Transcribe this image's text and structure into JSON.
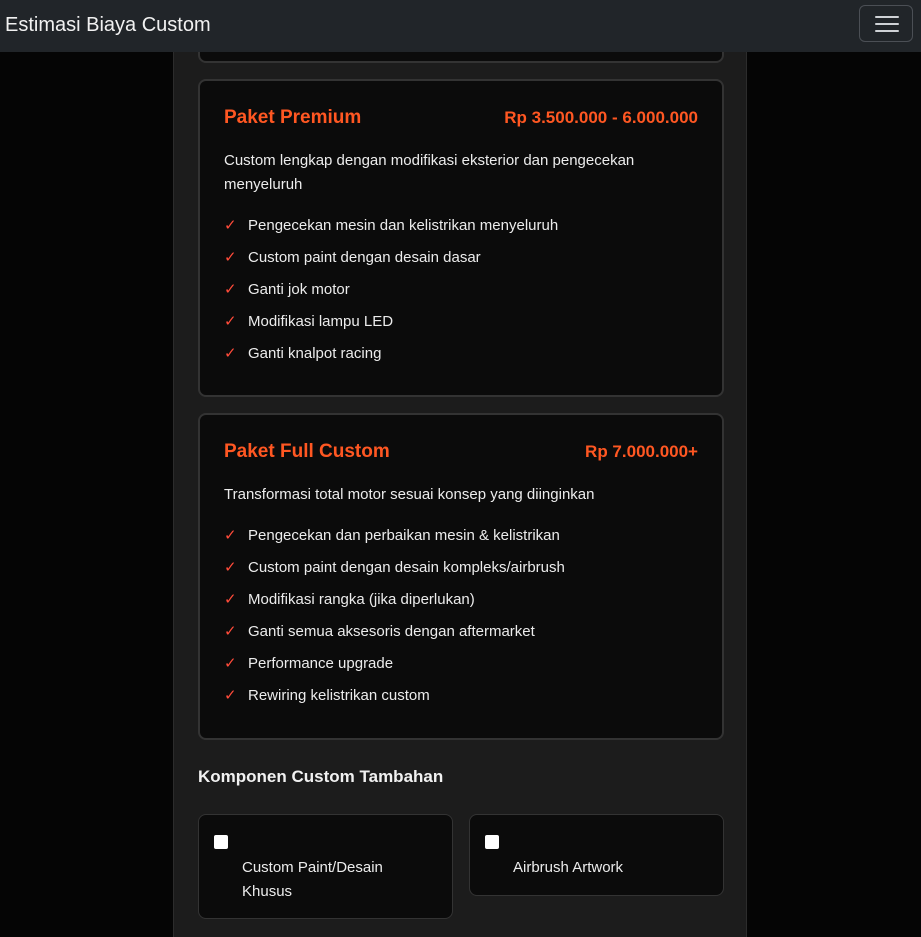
{
  "navbar": {
    "brand": "Estimasi Biaya Custom",
    "toggle_icon": "hamburger-menu-icon"
  },
  "packages": [
    {
      "title": "Paket Premium",
      "price": "Rp 3.500.000 - 6.000.000",
      "description": "Custom lengkap dengan modifikasi eksterior dan pengecekan menyeluruh",
      "features": [
        "Pengecekan mesin dan kelistrikan menyeluruh",
        "Custom paint dengan desain dasar",
        "Ganti jok motor",
        "Modifikasi lampu LED",
        "Ganti knalpot racing"
      ]
    },
    {
      "title": "Paket Full Custom",
      "price": "Rp 7.000.000+",
      "description": "Transformasi total motor sesuai konsep yang diinginkan",
      "features": [
        "Pengecekan dan perbaikan mesin & kelistrikan",
        "Custom paint dengan desain kompleks/airbrush",
        "Modifikasi rangka (jika diperlukan)",
        "Ganti semua aksesoris dengan aftermarket",
        "Performance upgrade",
        "Rewiring kelistrikan custom"
      ]
    }
  ],
  "check_glyph": "✓",
  "additional": {
    "title": "Komponen Custom Tambahan",
    "options": [
      {
        "label": "Custom Paint/Desain Khusus",
        "checked": false
      },
      {
        "label": "Airbrush Artwork",
        "checked": false
      }
    ]
  },
  "colors": {
    "accent": "#ff5722",
    "check": "#ff4b3a",
    "navbar_bg": "#212529",
    "card_bg": "#0b0b0b"
  }
}
